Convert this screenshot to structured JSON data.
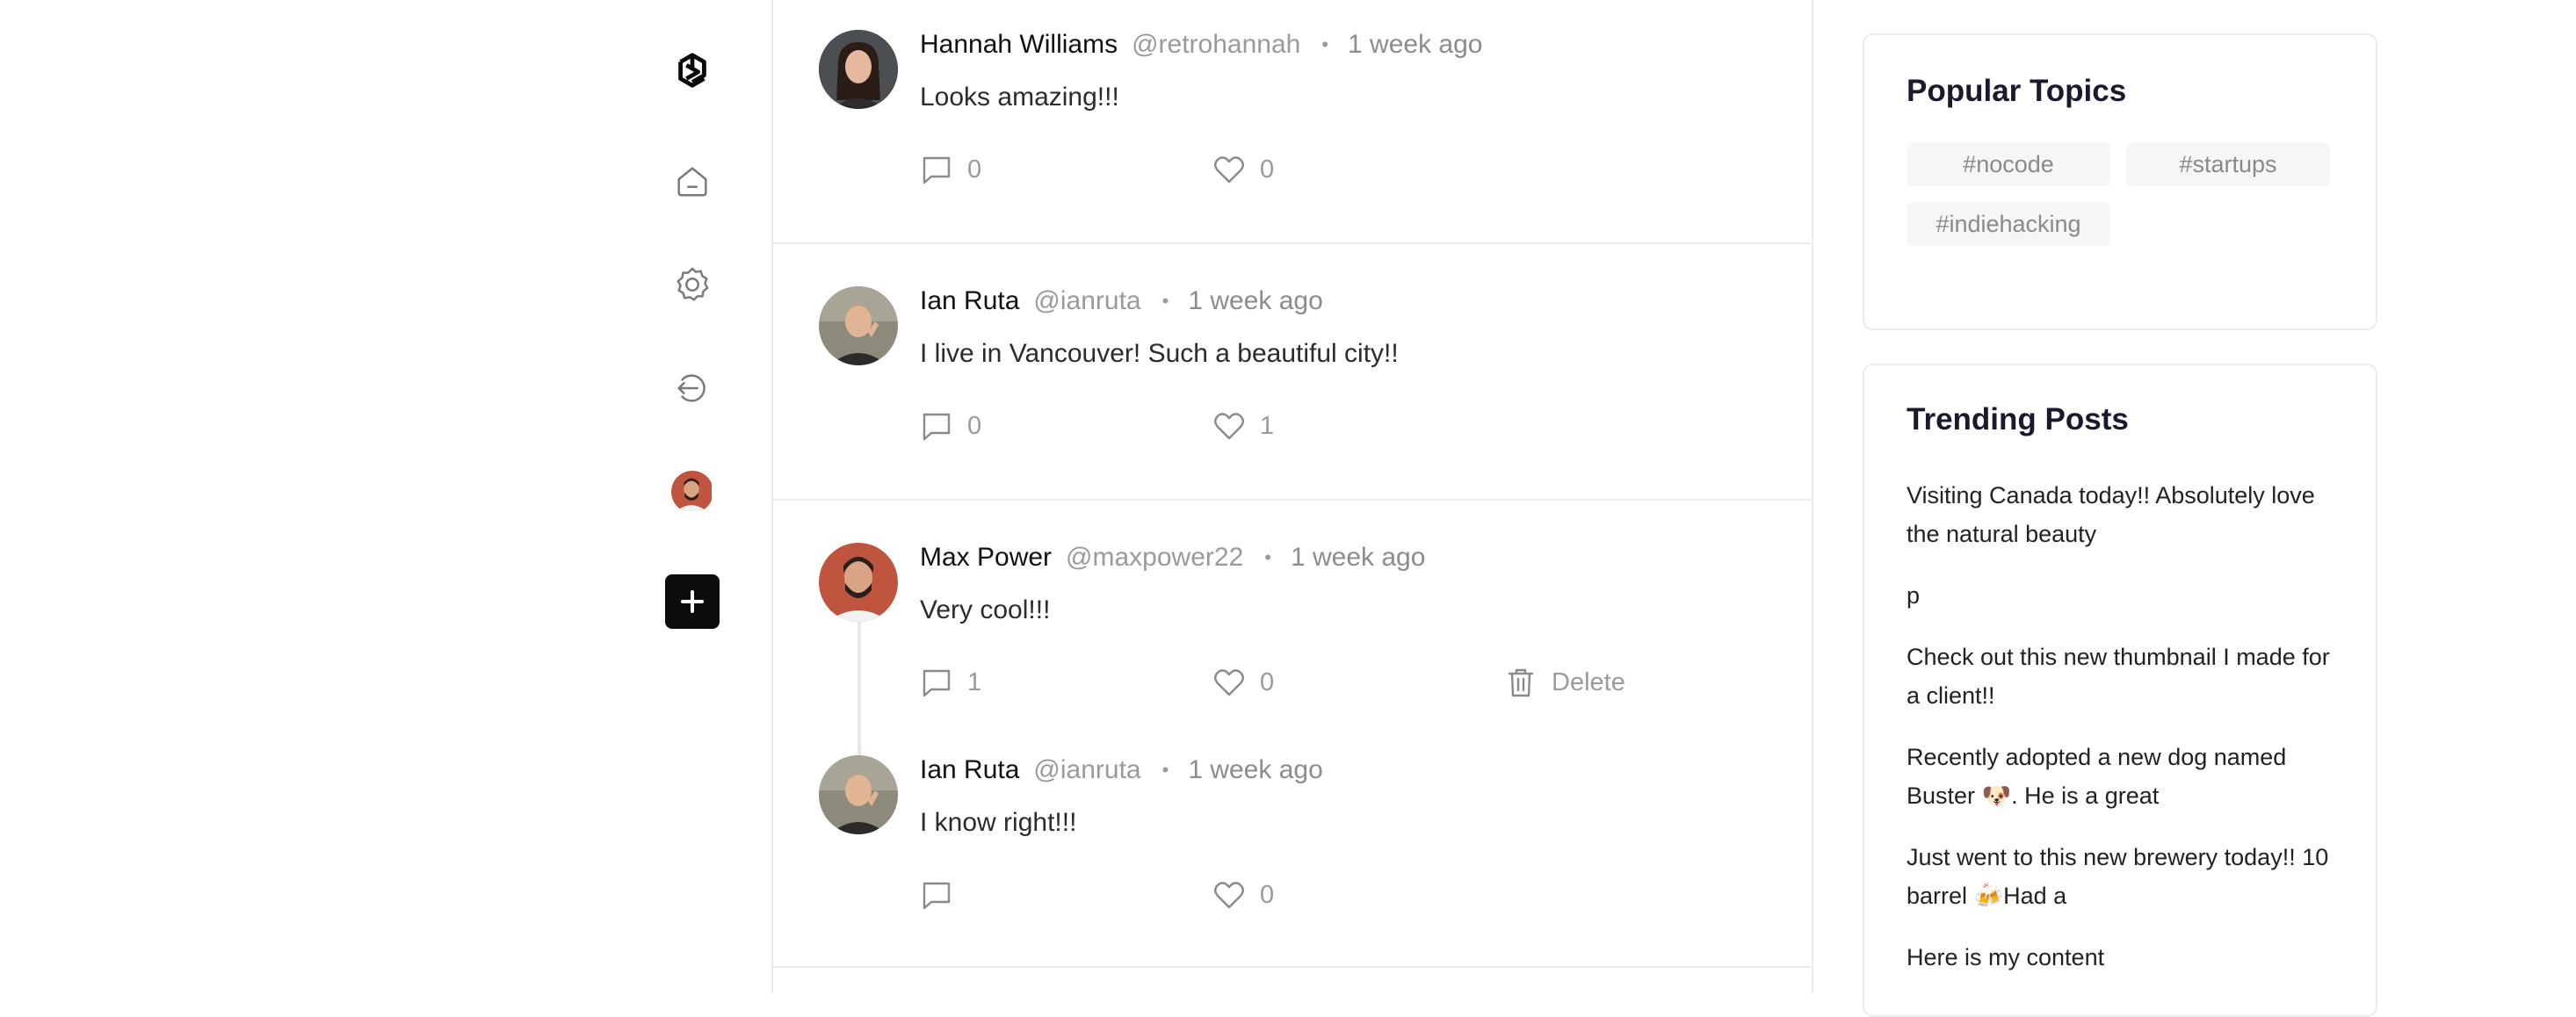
{
  "feed": {
    "posts": [
      {
        "name": "Hannah Williams",
        "handle": "@retrohannah",
        "time": "1 week ago",
        "text": "Looks amazing!!!",
        "comments": "0",
        "likes": "0"
      },
      {
        "name": "Ian Ruta",
        "handle": "@ianruta",
        "time": "1 week ago",
        "text": "I live in Vancouver! Such a beautiful city!!",
        "comments": "0",
        "likes": "1"
      },
      {
        "name": "Max Power",
        "handle": "@maxpower22",
        "time": "1 week ago",
        "text": "Very cool!!!",
        "comments": "1",
        "likes": "0",
        "delete_label": "Delete"
      },
      {
        "name": "Ian Ruta",
        "handle": "@ianruta",
        "time": "1 week ago",
        "text": "I know right!!!",
        "comments": "",
        "likes": "0"
      }
    ],
    "separator": "•"
  },
  "sidebar": {
    "icons": [
      "logo-icon",
      "home-icon",
      "gear-icon",
      "logout-icon",
      "profile-avatar",
      "plus-icon"
    ]
  },
  "popular": {
    "title": "Popular Topics",
    "topics": [
      "#nocode",
      "#startups",
      "#indiehacking"
    ]
  },
  "trending": {
    "title": "Trending Posts",
    "posts": [
      "Visiting Canada today!! Absolutely love the natural beauty",
      "p",
      "Check out this new thumbnail I made for a client!!",
      "Recently adopted a new dog named Buster 🐶. He is a great",
      "Just went to this new brewery today!! 10 barrel 🍻Had a",
      "Here is my content"
    ]
  },
  "colors": {
    "accent": "#0b0b0b",
    "muted": "#9a9a9a",
    "border": "#ececec",
    "chip_bg": "#f6f6f6"
  }
}
